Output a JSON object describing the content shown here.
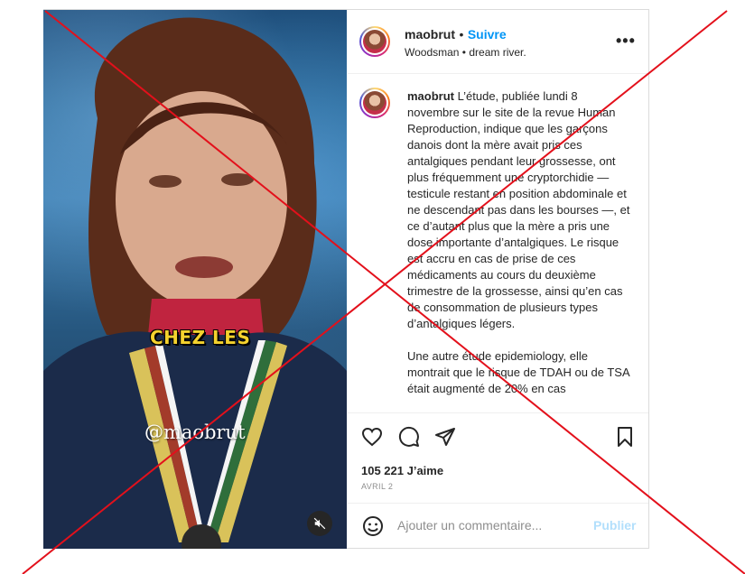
{
  "post": {
    "media": {
      "overlay_caption": "CHEZ LES",
      "watermark": "@maobrut",
      "mute_icon": "speaker-muted-icon"
    },
    "header": {
      "username": "maobrut",
      "separator": "•",
      "follow_label": "Suivre",
      "subtitle": "Woodsman • dream river.",
      "more_icon": "more-horizontal-icon",
      "more_label": "•••"
    },
    "caption": {
      "username": "maobrut",
      "text": "L’étude, publiée lundi 8 novembre sur le site de la revue Human Reproduction, indique que les garçons danois dont la mère avait pris ces antalgiques pendant leur grossesse, ont plus fréquemment une cryptorchidie — testicule restant en position abdominale et ne descendant pas dans les bourses —, et ce d’autant plus que la mère a pris une dose importante d’antalgiques. Le risque est accru en cas de prise de ces médicaments au cours du deuxième trimestre de la grossesse, ainsi qu’en cas de consommation de plusieurs types d’antalgiques légers.\n\nUne autre étude epidemiology, elle montrait que le risque de TDAH ou de TSA était augmenté de 20% en cas"
    },
    "actions": {
      "like_icon": "heart-icon",
      "comment_icon": "comment-icon",
      "share_icon": "send-icon",
      "save_icon": "bookmark-icon",
      "likes_label": "105 221 J’aime",
      "date_label": "AVRIL 2"
    },
    "comment_box": {
      "emoji_icon": "smiley-icon",
      "placeholder": "Ajouter un commentaire...",
      "publish_label": "Publier"
    }
  },
  "colors": {
    "accent": "#0095f6",
    "publish_disabled": "#b2dffc",
    "cross_overlay": "#e3101b",
    "caption_overlay": "#f4d22e"
  }
}
